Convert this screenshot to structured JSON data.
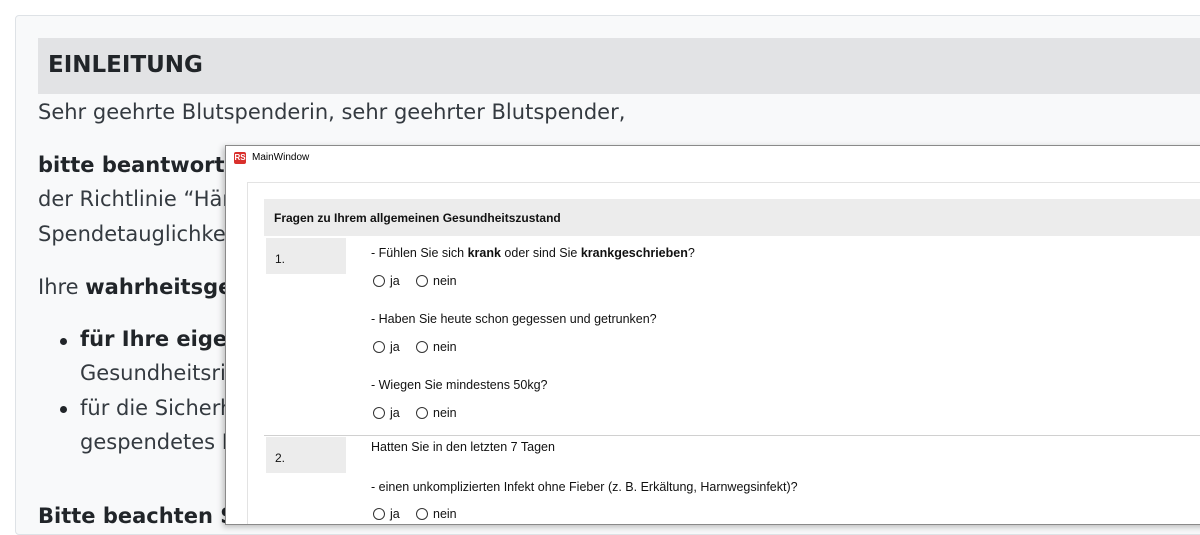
{
  "background_page": {
    "heading": "EINLEITUNG",
    "greeting": "Sehr geehrte Blutspenderin, sehr geehrter Blutspender,",
    "line_bitte": "bitte beantworte",
    "line_richtlinie": "der Richtlinie “Här",
    "line_spende": "Spendetauglichke",
    "line_ihre_prefix": "Ihre ",
    "line_ihre_bold": "wahrheitsgem",
    "bullet1_bold": "für Ihre eigen",
    "bullet1_cont": "Gesundheitsris",
    "bullet2": "für die Sicherh",
    "bullet2_cont": "gespendetes B",
    "line_bottom": "Bitte beachten Si"
  },
  "window": {
    "icon_label": "RS",
    "title": "MainWindow",
    "section_header": "Fragen zu Ihrem allgemeinen Gesundheitszustand",
    "questions": [
      {
        "number": "1.",
        "items": [
          {
            "text_parts": [
              "- Fühlen Sie sich ",
              "krank",
              " oder sind Sie ",
              "krankgeschrieben",
              "?"
            ],
            "options": [
              "ja",
              "nein"
            ]
          },
          {
            "text": "- Haben Sie heute schon gegessen und getrunken?",
            "options": [
              "ja",
              "nein"
            ]
          },
          {
            "text": "- Wiegen Sie mindestens 50kg?",
            "options": [
              "ja",
              "nein"
            ]
          }
        ]
      },
      {
        "number": "2.",
        "intro": "Hatten Sie in den letzten 7 Tagen",
        "items": [
          {
            "text": "- einen unkomplizierten Infekt ohne Fieber (z. B. Erkältung, Harnwegsinfekt)?",
            "options": [
              "ja",
              "nein"
            ]
          }
        ]
      }
    ]
  }
}
